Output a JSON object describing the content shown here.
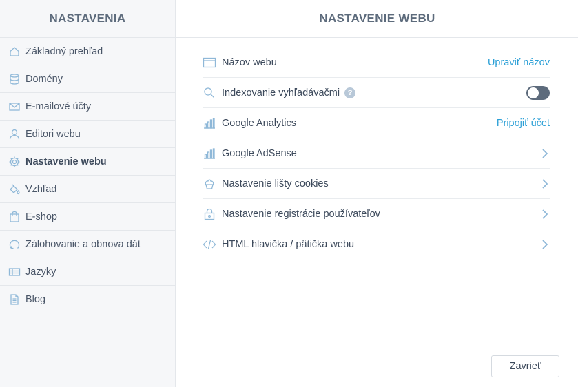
{
  "sidebar": {
    "title": "NASTAVENIA",
    "items": [
      {
        "label": "Základný prehľad",
        "icon": "home-icon"
      },
      {
        "label": "Domény",
        "icon": "database-icon"
      },
      {
        "label": "E-mailové účty",
        "icon": "envelope-icon"
      },
      {
        "label": "Editori webu",
        "icon": "user-icon"
      },
      {
        "label": "Nastavenie webu",
        "icon": "gear-icon",
        "active": true
      },
      {
        "label": "Vzhľad",
        "icon": "paint-bucket-icon"
      },
      {
        "label": "E-shop",
        "icon": "shopping-bag-icon"
      },
      {
        "label": "Zálohovanie a obnova dát",
        "icon": "backup-icon"
      },
      {
        "label": "Jazyky",
        "icon": "language-icon"
      },
      {
        "label": "Blog",
        "icon": "document-icon"
      }
    ]
  },
  "main": {
    "title": "NASTAVENIE WEBU",
    "rows": [
      {
        "label": "Názov webu",
        "icon": "browser-window-icon",
        "action": "Upraviť názov"
      },
      {
        "label": "Indexovanie vyhľadávačmi",
        "icon": "search-icon",
        "help": "?",
        "toggle_on": false
      },
      {
        "label": "Google Analytics",
        "icon": "bar-chart-icon",
        "action": "Pripojiť účet"
      },
      {
        "label": "Google AdSense",
        "icon": "bar-chart-icon"
      },
      {
        "label": "Nastavenie lišty cookies",
        "icon": "cupcake-icon"
      },
      {
        "label": "Nastavenie registrácie používateľov",
        "icon": "lock-icon"
      },
      {
        "label": "HTML hlavička / pätička webu",
        "icon": "code-icon"
      }
    ],
    "close_label": "Zavrieť"
  },
  "colors": {
    "accent": "#2a9fd6",
    "icon": "#8fb8d8",
    "toggle_off": "#5d6b7c",
    "sidebar_bg": "#f6f7f9"
  }
}
